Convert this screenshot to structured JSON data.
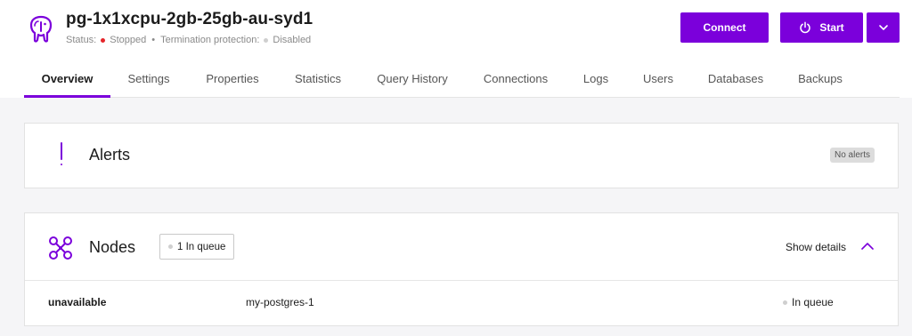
{
  "header": {
    "title": "pg-1x1xcpu-2gb-25gb-au-syd1",
    "status_label": "Status:",
    "status_value": "Stopped",
    "status_color": "#e5252a",
    "termination_label": "Termination protection:",
    "termination_value": "Disabled",
    "termination_color": "#cfcfcf",
    "logo_icon": "postgresql-elephant-icon"
  },
  "actions": {
    "connect_label": "Connect",
    "start_label": "Start",
    "start_icon": "power-icon",
    "more_icon": "chevron-down-icon",
    "accent_color": "#7b00db"
  },
  "tabs": [
    {
      "label": "Overview",
      "active": true
    },
    {
      "label": "Settings"
    },
    {
      "label": "Properties"
    },
    {
      "label": "Statistics"
    },
    {
      "label": "Query History"
    },
    {
      "label": "Connections"
    },
    {
      "label": "Logs"
    },
    {
      "label": "Users"
    },
    {
      "label": "Databases"
    },
    {
      "label": "Backups"
    }
  ],
  "alerts": {
    "title": "Alerts",
    "badge": "No alerts",
    "icon": "exclamation-icon"
  },
  "nodes": {
    "title": "Nodes",
    "icon": "nodes-network-icon",
    "queue_badge": "1 In queue",
    "show_details": "Show details",
    "rows": [
      {
        "status": "unavailable",
        "name": "my-postgres-1",
        "state": "In queue"
      }
    ]
  }
}
